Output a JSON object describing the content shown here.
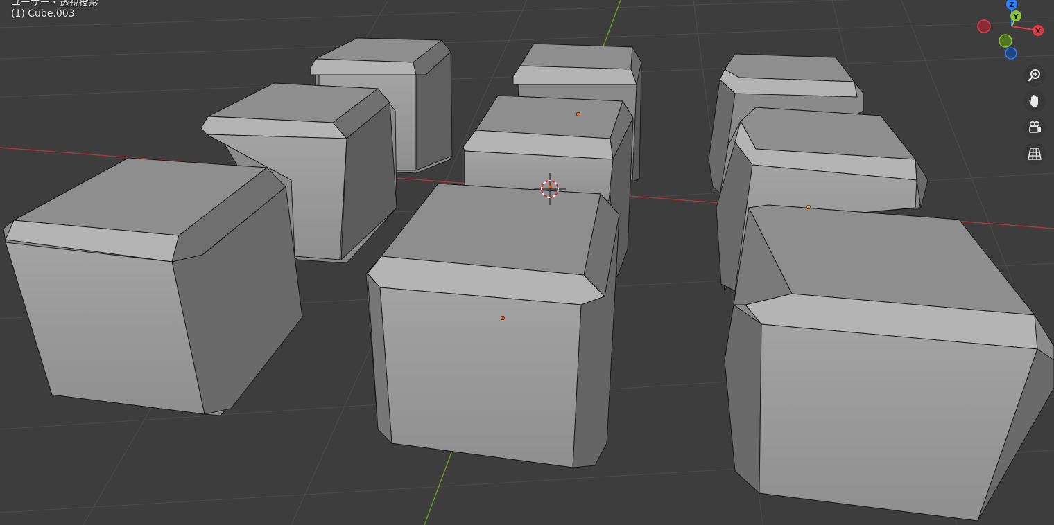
{
  "viewport": {
    "view_name": "ユーザー・透視投影",
    "active_object": "(1) Cube.003"
  },
  "gizmo": {
    "axes": [
      {
        "label": "Z",
        "color": "#2b7fff"
      },
      {
        "label": "Y",
        "color": "#8cc63f"
      },
      {
        "label": "X",
        "color": "#e23c4a"
      }
    ]
  },
  "toolbar": {
    "tools": [
      {
        "name": "zoom",
        "icon": "zoom-icon"
      },
      {
        "name": "pan",
        "icon": "hand-icon"
      },
      {
        "name": "camera",
        "icon": "camera-icon"
      },
      {
        "name": "perspective",
        "icon": "grid-icon"
      }
    ]
  },
  "colors": {
    "background": "#3d3d3d",
    "grid": "#4a4a4a",
    "x_axis": "#b5313a",
    "y_axis": "#6ea02a",
    "mesh": "#9a9a9a",
    "origin": "#e2631a"
  }
}
